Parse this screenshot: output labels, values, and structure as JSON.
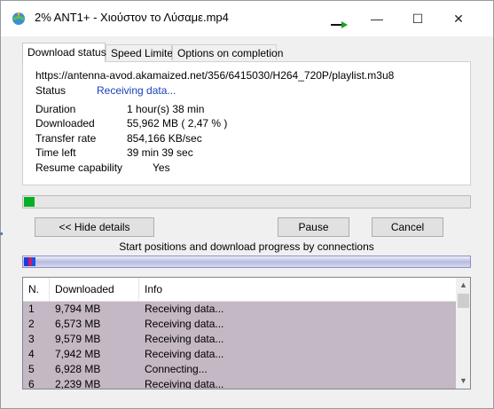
{
  "window": {
    "title": "2% ANT1+ - Χιούστον το Λύσαμε.mp4",
    "controls": {
      "minimize": "—",
      "maximize": "☐",
      "close": "✕"
    }
  },
  "tabs": [
    {
      "label": "Download status",
      "active": true
    },
    {
      "label": "Speed Limiter",
      "active": false
    },
    {
      "label": "Options on completion",
      "active": false
    }
  ],
  "status": {
    "url": "https://antenna-avod.akamaized.net/356/6415030/H264_720P/playlist.m3u8",
    "status_label": "Status",
    "status_value": "Receiving data...",
    "rows": [
      {
        "label": "Duration",
        "value": "1 hour(s) 38 min"
      },
      {
        "label": "Downloaded",
        "value": "55,962  MB  ( 2,47 % )"
      },
      {
        "label": "Transfer rate",
        "value": "854,166  KB/sec"
      },
      {
        "label": "Time left",
        "value": "39 min 39 sec"
      },
      {
        "label": "Resume capability",
        "value": "Yes"
      }
    ]
  },
  "progress": {
    "fraction": 0.0247,
    "color": "#06b025"
  },
  "buttons": {
    "hide_details": "<< Hide details",
    "pause": "Pause",
    "cancel": "Cancel"
  },
  "connections": {
    "caption": "Start positions and download progress by connections",
    "colors": [
      "#1e3cdc",
      "#c0206a",
      "#2050e8"
    ]
  },
  "table": {
    "columns": [
      "N.",
      "Downloaded",
      "Info"
    ],
    "rows": [
      {
        "n": "1",
        "downloaded": "9,794  MB",
        "info": "Receiving data..."
      },
      {
        "n": "2",
        "downloaded": "6,573  MB",
        "info": "Receiving data..."
      },
      {
        "n": "3",
        "downloaded": "9,579  MB",
        "info": "Receiving data..."
      },
      {
        "n": "4",
        "downloaded": "7,942  MB",
        "info": "Receiving data..."
      },
      {
        "n": "5",
        "downloaded": "6,928  MB",
        "info": "Connecting..."
      },
      {
        "n": "6",
        "downloaded": "2,239  MB",
        "info": "Receiving data..."
      }
    ],
    "row_color": "#c4b8c4"
  },
  "icons": {
    "app": "idm-globe-icon",
    "arrow": "green-arrow-icon",
    "scroll_up": "scroll-up-icon",
    "scroll_down": "scroll-down-icon"
  }
}
